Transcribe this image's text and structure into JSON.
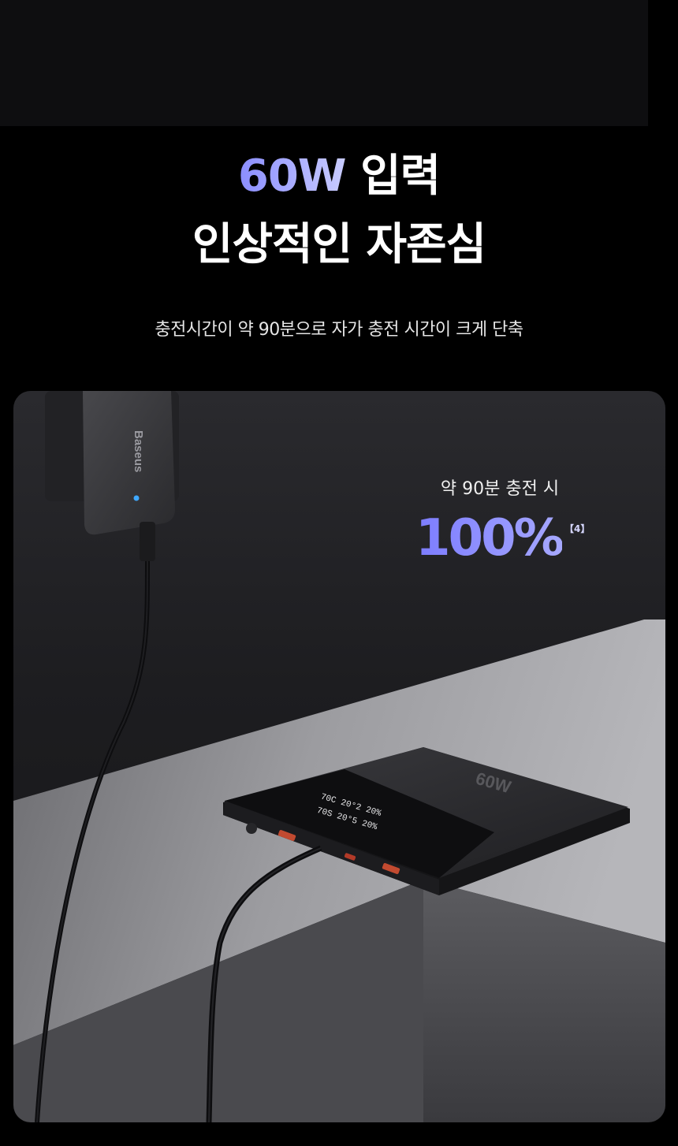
{
  "headline": {
    "accent": "60W",
    "line1_rest": " 입력",
    "line2": "인상적인 자존심"
  },
  "subtitle": "충전시간이 약 90분으로 자가 충전 시간이 크게 단축",
  "stat": {
    "label": "약 90분 충전 시",
    "value": "100%",
    "footnote": "【4】"
  },
  "product": {
    "charger_brand": "Baseus",
    "display_rows": [
      "70C 20°2 20%",
      "70S 20°5 20%"
    ],
    "capacity_mark": "60W"
  },
  "colors": {
    "accent": "#8a8dff",
    "background": "#000000"
  }
}
